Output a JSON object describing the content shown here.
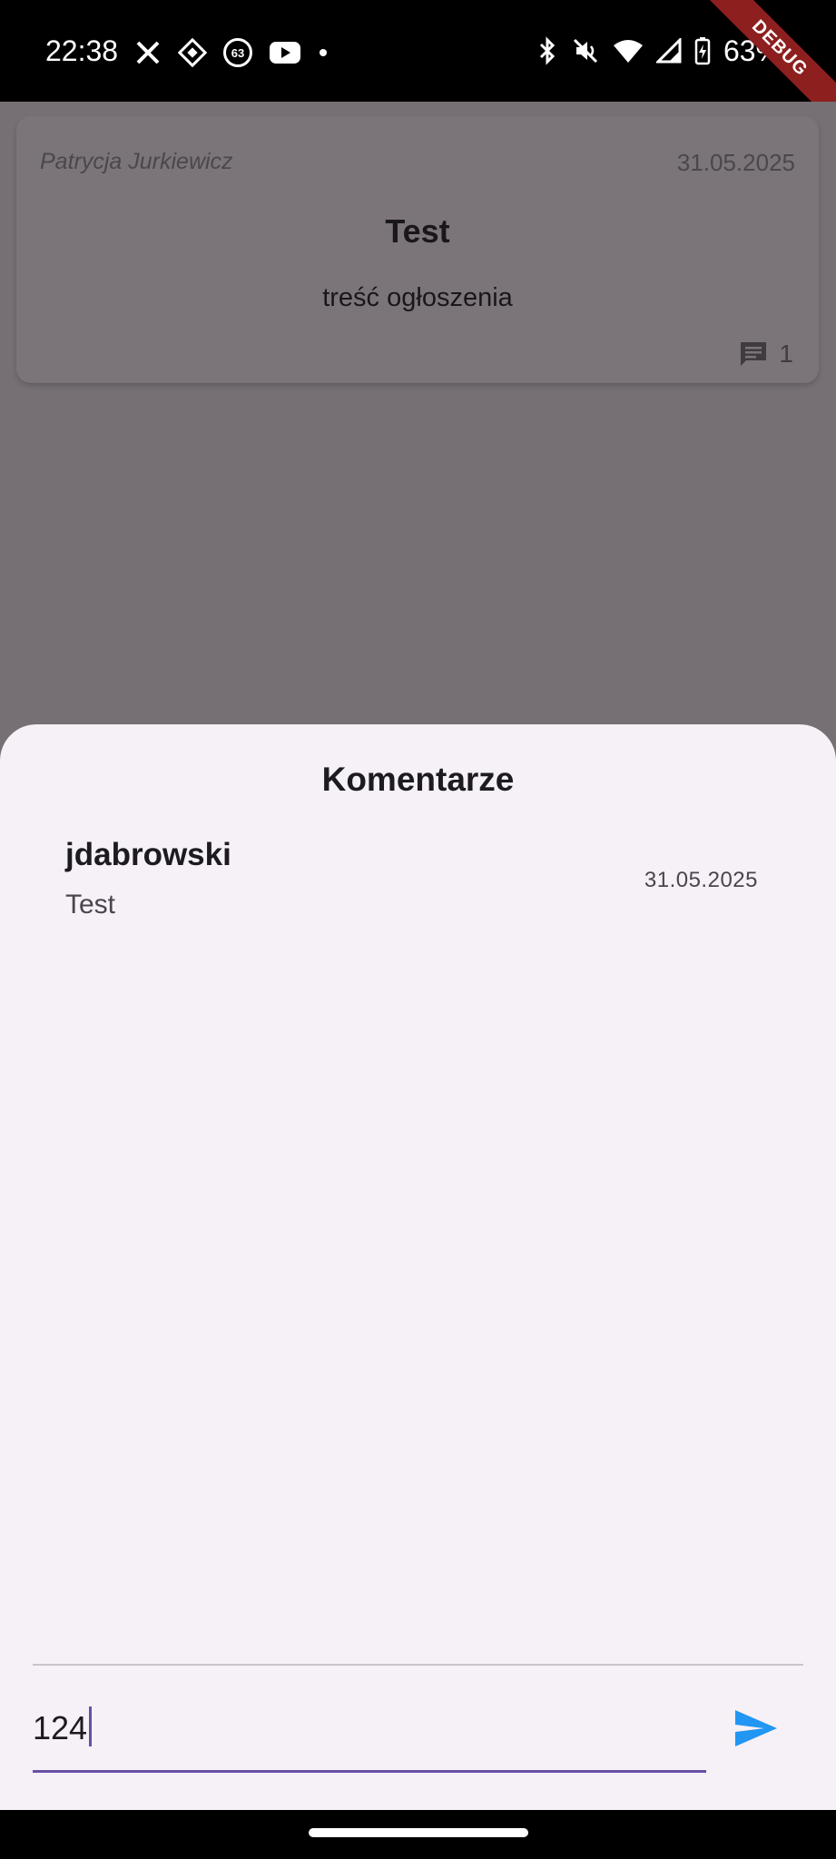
{
  "status_bar": {
    "time": "22:38",
    "notification_badge": "63",
    "battery": "63%",
    "icons": [
      "x-icon",
      "grid-app-icon",
      "badge-63-icon",
      "youtube-icon",
      "dot-icon",
      "bluetooth-icon",
      "mute-icon",
      "wifi-icon",
      "signal-icon",
      "battery-charging-icon"
    ]
  },
  "debug_banner": "DEBUG",
  "post": {
    "author": "Patrycja Jurkiewicz",
    "date": "31.05.2025",
    "title": "Test",
    "body": "treść ogłoszenia",
    "comment_count": "1"
  },
  "comments_sheet": {
    "title": "Komentarze",
    "comments": [
      {
        "author": "jdabrowski",
        "text": "Test",
        "date": "31.05.2025"
      }
    ],
    "input": {
      "value": "124",
      "placeholder": ""
    }
  },
  "colors": {
    "accent": "#6750a4",
    "send": "#2196f3",
    "sheet_bg": "#f6f0f7",
    "scrim_bg": "#767074"
  }
}
